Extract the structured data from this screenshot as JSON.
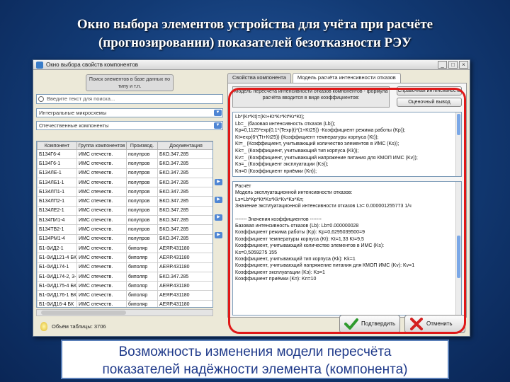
{
  "slide": {
    "title_line1": "Окно выбора элементов устройства для учёта при расчёте",
    "title_line2": "(прогнозировании) показателей безотказности РЭУ",
    "caption_line1": "Возможность изменения модели пересчёта",
    "caption_line2": "показателей надёжности элемента (компонента)"
  },
  "window": {
    "title": "Окно выбора свойств компонентов",
    "controls": [
      "_",
      "□",
      "×"
    ]
  },
  "left": {
    "note": "Поиск элементов в базе данных по типу и т.п.",
    "search_placeholder": "Введите текст для поиска...",
    "filter1": "Интегральные микросхемы",
    "filter2": "Отечественные компоненты",
    "grid": {
      "columns": [
        "Компонент",
        "Группа компонентов",
        "Производ.",
        "Документация"
      ],
      "rows": [
        [
          "Б134Г6-4",
          "ИМС отечеств.",
          "полупров",
          "БКО.347.285"
        ],
        [
          "Б134Г6-1",
          "ИМС отечеств.",
          "полупров",
          "БКО.347.285"
        ],
        [
          "Б134ЛЕ-1",
          "ИМС отечеств.",
          "полупров",
          "БКО.347.285"
        ],
        [
          "Б134ЛБ1-1",
          "ИМС отечеств.",
          "полупров",
          "БКО.347.285"
        ],
        [
          "Б134ЛП1-1",
          "ИМС отечеств.",
          "полупров",
          "БКО.347.285"
        ],
        [
          "Б134ЛП2-1",
          "ИМС отечеств.",
          "полупров",
          "БКО.347.285"
        ],
        [
          "Б134ЛЕ2-1",
          "ИМС отечеств.",
          "полупров",
          "БКО.347.285"
        ],
        [
          "Б134ПИ1-4",
          "ИМС отечеств.",
          "полупров",
          "БКО.347.285"
        ],
        [
          "Б134ТВ2-1",
          "ИМС отечеств.",
          "полупров",
          "БКО.347.285"
        ],
        [
          "Б134РМ1-4",
          "ИМС отечеств.",
          "полупров",
          "БКО.347.285"
        ],
        [
          "Б1-0ИД2-1",
          "ИМС отечеств.",
          "биполяр",
          "АЕЯР.431180"
        ],
        [
          "Б1-0ИД121-4 БК",
          "ИМС отечеств.",
          "биполяр",
          "АЕЯР.431180"
        ],
        [
          "Б1-0ИД174-1",
          "ИМС отечеств.",
          "биполяр",
          "АЕЯР.431180"
        ],
        [
          "Б1-0ИД174-2, 3-2",
          "ИМС отечеств.",
          "биполяр",
          "БКО.347.285"
        ],
        [
          "Б1-0ИД175-4 БК",
          "ИМС отечеств.",
          "биполяр",
          "АЕЯР.431180"
        ],
        [
          "Б1-0ИД176-1 БК",
          "ИМС отечеств.",
          "биполяр",
          "АЕЯР.431180"
        ],
        [
          "Б1-0ИД16-4 БК",
          "ИМС отечеств.",
          "биполяр",
          "АЕЯР.431180"
        ],
        [
          "Б1-0ИД2-05-1 БК",
          "ИМС отечеств.",
          "биполяр",
          "АЕЯР.431180"
        ]
      ]
    },
    "status": "Объём таблицы: 3706"
  },
  "right": {
    "tabs": [
      "Свойства компонента",
      "Модель расчёта интенсивности отказов"
    ],
    "model_label": "Модель пересчёта интенсивности отказов компонентов - формула расчёта вводится в виде коэффициентов:",
    "btn_reference": "Справочная интенсивность",
    "btn_estimate": "Оценочный вывод",
    "formula_lines": [
      "Lb*(Kr*Kt)=(Kt+Kt*Kr*Kt*Kr*Kt);",
      "Lb=_ (базовая интенсивность отказов (Lb));",
      "Kp=0,1125*exp(0,1*(Texp(t)*(1+Kt25)) -Коэффициент режима работы (Kp));",
      "Kt=exp(6*(Tt+Kt25)) (Коэффициент температуры корпуса (Kt));",
      "Kt=_ (Коэффициент, учитывающий количество элементов в ИМС (Ks));",
      "Kk=_ (Коэффициент, учитывающий тип корпуса (Kk));",
      "Kv=_ (Коэффициент, учитывающий напряжение питания для КМОП ИМС (Kv));",
      "Kэ=_ (Коэффициент эксплуатации (Kэ));",
      "Kп=0 (Коэффициент приёмки (Kп));"
    ],
    "calc_lines": [
      "Расчёт",
      "Модель эксплуатационной интенсивности отказов:",
      "Lэ=Lb*Kp*Kt*Ks*Kk*Kv*Kэ*Kп;",
      "Значение эксплуатационной интенсивности отказов Lэ= 0.000001255773 1/ч",
      "",
      "------- Значения коэффициентов -------",
      "Базовая интенсивность отказов (Lb): Lb=0.000000028",
      "Коэффициент режима работы (Kp): Kp=0,6295039500=9",
      "Коэффициент температуры корпуса (Kt): Kt=1,33 Kt=9,5",
      "Коэффициент, учитывающий количество элементов в ИМС (Ks):",
      "Ks=0,5059275 155",
      "Коэффициент, учитывающий тип корпуса (Kk): Kk=1",
      "Коэффициент, учитывающий напряжение питания для КМОП ИМС (Kv): Kv=1",
      "Коэффициент эксплуатации (Kэ): Kэ=1",
      "Коэффициент приёмки (Kп): Kп=10"
    ]
  },
  "buttons": {
    "confirm": "Подтвердить",
    "cancel": "Отменить"
  },
  "colors": {
    "highlight": "#e01818",
    "caption_text": "#1f3a8a",
    "background": "#123a74"
  }
}
